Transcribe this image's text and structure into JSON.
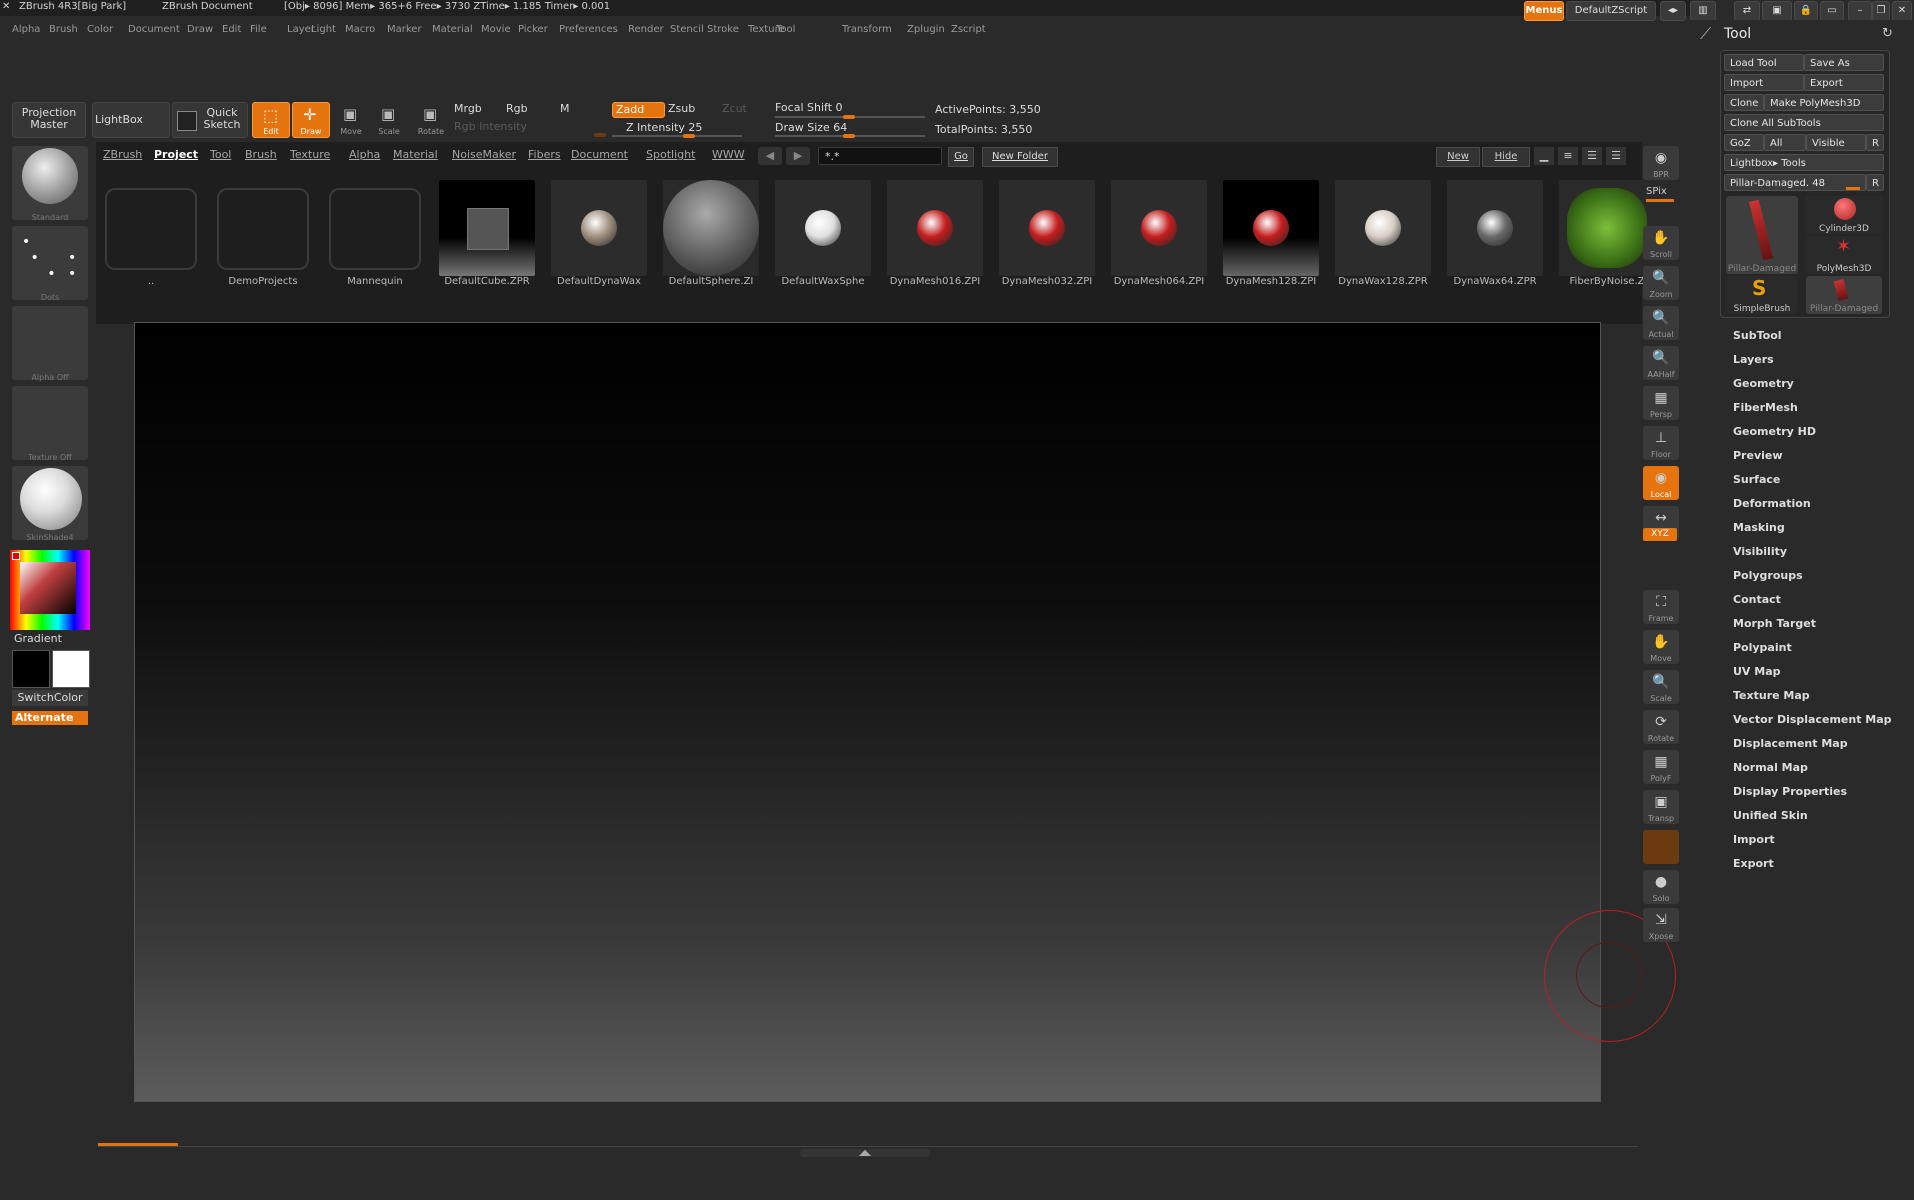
{
  "titlebar": {
    "app": "ZBrush 4R3[Big Park]",
    "doc": "ZBrush Document",
    "stats": "[Obj▸ 8096] Mem▸ 365+6 Free▸ 3730 ZTime▸ 1.185 Timer▸ 0.001",
    "menus_btn": "Menus",
    "script_btn": "DefaultZScript"
  },
  "menubar": [
    "Alpha",
    "Brush",
    "Color",
    "Document",
    "Draw",
    "Edit",
    "File",
    "Layer",
    "Light",
    "Macro",
    "Marker",
    "Material",
    "Movie",
    "Picker",
    "Preferences",
    "Render",
    "Stencil",
    "Stroke",
    "Texture",
    "Tool",
    "Transform",
    "Zplugin",
    "Zscript"
  ],
  "toolbar": {
    "projection_master": "Projection Master",
    "lightbox": "LightBox",
    "quick_sketch": "Quick Sketch",
    "edit": "Edit",
    "draw": "Draw",
    "move": "Move",
    "scale": "Scale",
    "rotate": "Rotate",
    "mrgb": "Mrgb",
    "rgb": "Rgb",
    "m": "M",
    "rgb_intensity": "Rgb  Intensity",
    "zadd": "Zadd",
    "zsub": "Zsub",
    "zcut": "Zcut",
    "z_intensity": "Z Intensity 25",
    "focal_shift": "Focal Shift 0",
    "draw_size": "Draw Size 64",
    "active_points": "ActivePoints: 3,550",
    "total_points": "TotalPoints: 3,550"
  },
  "leftshelf": {
    "brush": "Standard",
    "stroke": "Dots",
    "alpha": "Alpha  Off",
    "texture": "Texture  Off",
    "material": "SkinShade4",
    "gradient": "Gradient",
    "switchcolor": "SwitchColor",
    "alternate": "Alternate"
  },
  "lightbox": {
    "tabs": [
      "ZBrush",
      "Project",
      "Tool",
      "Brush",
      "Texture",
      "Alpha",
      "Material",
      "NoiseMaker",
      "Fibers",
      "Document",
      "Spotlight",
      "WWW"
    ],
    "active_tab": "Project",
    "go": "Go",
    "new_folder": "New Folder",
    "filter": "*.*",
    "new": "New",
    "hide": "Hide",
    "items": [
      "..",
      "DemoProjects",
      "Mannequin",
      "DefaultCube.ZPR",
      "DefaultDynaWax",
      "DefaultSphere.ZI",
      "DefaultWaxSphe",
      "DynaMesh016.ZPI",
      "DynaMesh032.ZPI",
      "DynaMesh064.ZPI",
      "DynaMesh128.ZPI",
      "DynaWax128.ZPR",
      "DynaWax64.ZPR",
      "FiberByNoise.Z"
    ]
  },
  "rightdock": [
    "BPR",
    "SPix",
    "Scroll",
    "Zoom",
    "Actual",
    "AAHalf",
    "Persp",
    "Floor",
    "Local",
    "L.Sym",
    "XYZ",
    "Frame",
    "Move",
    "Scale",
    "Rotate",
    "PolyF",
    "Transp",
    "Solo",
    "Xpose"
  ],
  "toolpanel": {
    "title": "Tool",
    "load_tool": "Load Tool",
    "save_as": "Save As",
    "import": "Import",
    "export": "Export",
    "clone": "Clone",
    "make_polymesh": "Make PolyMesh3D",
    "clone_all": "Clone  All  SubTools",
    "goz": "GoZ",
    "all": "All",
    "visible": "Visible",
    "r": "R",
    "lightbox_tools": "Lightbox▸ Tools",
    "current_tool": "Pillar-Damaged. 48",
    "thumbs": [
      "Pillar-Damaged",
      "Cylinder3D",
      "PolyMesh3D",
      "SimpleBrush",
      "Pillar-Damaged"
    ],
    "sections": [
      "SubTool",
      "Layers",
      "Geometry",
      "FiberMesh",
      "Geometry HD",
      "Preview",
      "Surface",
      "Deformation",
      "Masking",
      "Visibility",
      "Polygroups",
      "Contact",
      "Morph Target",
      "Polypaint",
      "UV Map",
      "Texture Map",
      "Vector Displacement Map",
      "Displacement Map",
      "Normal Map",
      "Display Properties",
      "Unified Skin",
      "Import",
      "Export"
    ]
  },
  "colors": {
    "accent": "#e5740f",
    "bg": "#2a2a2a",
    "panel": "#1e1e1e"
  }
}
